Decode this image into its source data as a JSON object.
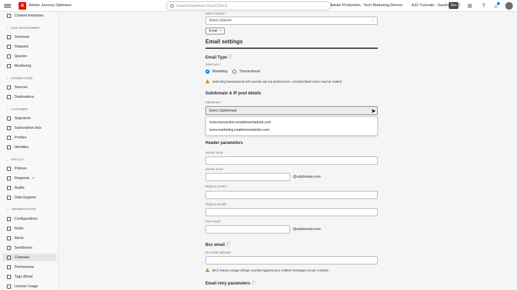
{
  "topbar": {
    "app_title": "Adobe Journey Optimizer",
    "search_placeholder": "Search Experience Cloud (Ctrl+/)",
    "org": "Adobe Production - Tech Marketing Demos",
    "user": "AJO Tutorials - Sandra (VAT)",
    "env_badge": "Dev",
    "logo_letter": "A"
  },
  "sidebar": {
    "items": [
      {
        "label": "Content templates"
      },
      {
        "label": "Schemas"
      },
      {
        "label": "Datasets"
      },
      {
        "label": "Queries"
      },
      {
        "label": "Monitoring"
      },
      {
        "label": "Sources"
      },
      {
        "label": "Destinations"
      },
      {
        "label": "Segments"
      },
      {
        "label": "Subscription lists"
      },
      {
        "label": "Profiles"
      },
      {
        "label": "Identities"
      },
      {
        "label": "Policies"
      },
      {
        "label": "Requests"
      },
      {
        "label": "Audits"
      },
      {
        "label": "Data Hygiene"
      },
      {
        "label": "Configurations"
      },
      {
        "label": "Rules"
      },
      {
        "label": "Alerts"
      },
      {
        "label": "Sandboxes"
      },
      {
        "label": "Channels"
      },
      {
        "label": "Permissions"
      },
      {
        "label": "Tags (Beta)"
      },
      {
        "label": "License Usage"
      }
    ],
    "sections": {
      "data_management": "DATA MANAGEMENT",
      "connections": "CONNECTIONS",
      "customer": "CUSTOMER",
      "privacy": "PRIVACY",
      "administration": "ADMINISTRATION"
    }
  },
  "form": {
    "select_channel_label": "Select channel",
    "select_channel_placeholder": "Select channel",
    "channel_tag": "Email",
    "email_settings_title": "Email settings",
    "email_type_title": "Email Type",
    "select_one_label": "Select one",
    "marketing_label": "Marketing",
    "transactional_label": "Transactional",
    "transactional_warning": "Selecting transactional will override opt-out preferences. Unsubscribed users may be mailed.",
    "subdomain_title": "Subdomain & IP pool details",
    "subdomain_label": "Subdomain",
    "subdomain_placeholder": "Select Subdomain",
    "subdomain_options": [
      "luma-transaction.enablementadobe.com",
      "luma-marketing.enablementadobe.com"
    ],
    "header_params_title": "Header parameters",
    "sender_name_label": "Sender name",
    "sender_email_label": "Sender email",
    "sender_email_suffix": "@subdomain.com",
    "reply_name_label": "Reply to (name)",
    "reply_email_label": "Reply to (email)",
    "error_email_label": "Error email",
    "error_email_suffix": "@subdomain.com",
    "bcc_title": "Bcc email",
    "bcc_optional_label": "Bcc email (optional)",
    "bcc_warning": "BCC feature usage will get counted against your entitled messages as per contract.",
    "retry_title": "Email retry parameters",
    "required_mark": "*"
  }
}
